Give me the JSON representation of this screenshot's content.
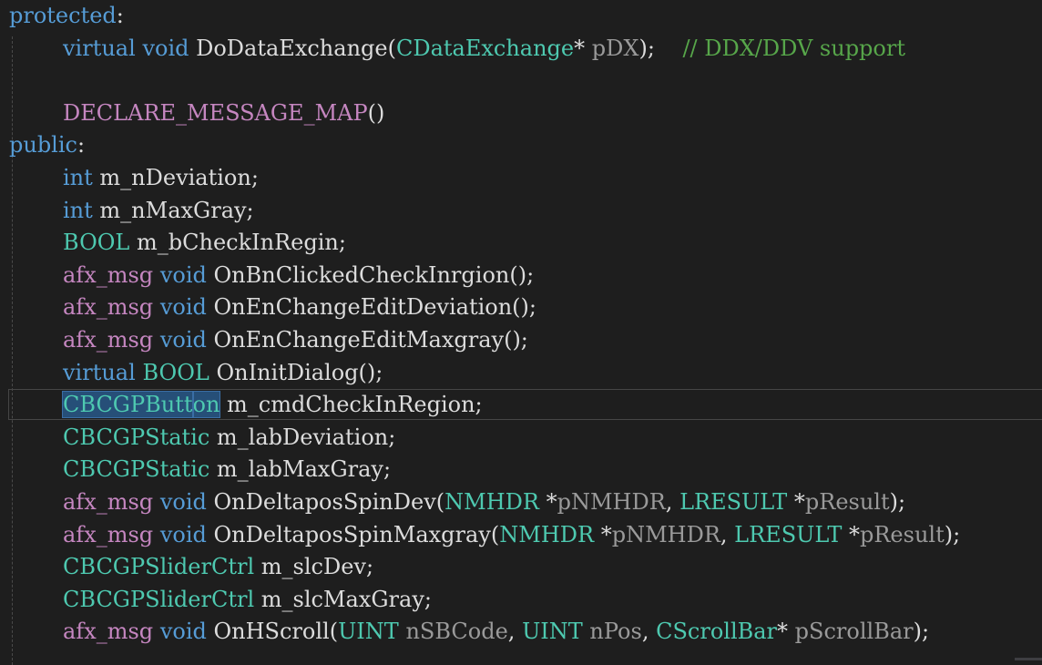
{
  "editor": {
    "lines": [
      {
        "indent": 0,
        "tokens": [
          {
            "t": "protected",
            "c": "kw"
          },
          {
            "t": ":",
            "c": "plain"
          }
        ]
      },
      {
        "indent": 1,
        "tokens": [
          {
            "t": "virtual",
            "c": "kw"
          },
          {
            "t": " ",
            "c": "plain"
          },
          {
            "t": "void",
            "c": "kw"
          },
          {
            "t": " DoDataExchange(",
            "c": "plain"
          },
          {
            "t": "CDataExchange",
            "c": "type"
          },
          {
            "t": "* ",
            "c": "plain"
          },
          {
            "t": "pDX",
            "c": "param"
          },
          {
            "t": ");    ",
            "c": "plain"
          },
          {
            "t": "// DDX/DDV support",
            "c": "cmt"
          }
        ]
      },
      {
        "indent": 1,
        "tokens": []
      },
      {
        "indent": 1,
        "tokens": [
          {
            "t": "DECLARE_MESSAGE_MAP",
            "c": "macro"
          },
          {
            "t": "()",
            "c": "plain"
          }
        ]
      },
      {
        "indent": 0,
        "tokens": [
          {
            "t": "public",
            "c": "kw"
          },
          {
            "t": ":",
            "c": "plain"
          }
        ]
      },
      {
        "indent": 1,
        "tokens": [
          {
            "t": "int",
            "c": "kw"
          },
          {
            "t": " m_nDeviation;",
            "c": "plain"
          }
        ]
      },
      {
        "indent": 1,
        "tokens": [
          {
            "t": "int",
            "c": "kw"
          },
          {
            "t": " m_nMaxGray;",
            "c": "plain"
          }
        ]
      },
      {
        "indent": 1,
        "tokens": [
          {
            "t": "BOOL",
            "c": "type"
          },
          {
            "t": " m_bCheckInRegin;",
            "c": "plain"
          }
        ]
      },
      {
        "indent": 1,
        "tokens": [
          {
            "t": "afx_msg",
            "c": "macro"
          },
          {
            "t": " ",
            "c": "plain"
          },
          {
            "t": "void",
            "c": "kw"
          },
          {
            "t": " OnBnClickedCheckInrgion();",
            "c": "plain"
          }
        ]
      },
      {
        "indent": 1,
        "tokens": [
          {
            "t": "afx_msg",
            "c": "macro"
          },
          {
            "t": " ",
            "c": "plain"
          },
          {
            "t": "void",
            "c": "kw"
          },
          {
            "t": " OnEnChangeEditDeviation();",
            "c": "plain"
          }
        ]
      },
      {
        "indent": 1,
        "tokens": [
          {
            "t": "afx_msg",
            "c": "macro"
          },
          {
            "t": " ",
            "c": "plain"
          },
          {
            "t": "void",
            "c": "kw"
          },
          {
            "t": " OnEnChangeEditMaxgray();",
            "c": "plain"
          }
        ]
      },
      {
        "indent": 1,
        "tokens": [
          {
            "t": "virtual",
            "c": "kw"
          },
          {
            "t": " ",
            "c": "plain"
          },
          {
            "t": "BOOL",
            "c": "type"
          },
          {
            "t": " OnInitDialog();",
            "c": "plain"
          }
        ]
      },
      {
        "indent": 1,
        "current": true,
        "tokens": [
          {
            "t": "CBCGPButt",
            "c": "type",
            "sel": true
          },
          {
            "caret": true
          },
          {
            "t": "on",
            "c": "type",
            "sel": true
          },
          {
            "t": " m_cmdCheckInRegion;",
            "c": "plain"
          }
        ]
      },
      {
        "indent": 1,
        "tokens": [
          {
            "t": "CBCGPStatic",
            "c": "type"
          },
          {
            "t": " m_labDeviation;",
            "c": "plain"
          }
        ]
      },
      {
        "indent": 1,
        "tokens": [
          {
            "t": "CBCGPStatic",
            "c": "type"
          },
          {
            "t": " m_labMaxGray;",
            "c": "plain"
          }
        ]
      },
      {
        "indent": 1,
        "tokens": [
          {
            "t": "afx_msg",
            "c": "macro"
          },
          {
            "t": " ",
            "c": "plain"
          },
          {
            "t": "void",
            "c": "kw"
          },
          {
            "t": " OnDeltaposSpinDev(",
            "c": "plain"
          },
          {
            "t": "NMHDR",
            "c": "type"
          },
          {
            "t": " *",
            "c": "plain"
          },
          {
            "t": "pNMHDR",
            "c": "param"
          },
          {
            "t": ", ",
            "c": "plain"
          },
          {
            "t": "LRESULT",
            "c": "type"
          },
          {
            "t": " *",
            "c": "plain"
          },
          {
            "t": "pResult",
            "c": "param"
          },
          {
            "t": ");",
            "c": "plain"
          }
        ]
      },
      {
        "indent": 1,
        "tokens": [
          {
            "t": "afx_msg",
            "c": "macro"
          },
          {
            "t": " ",
            "c": "plain"
          },
          {
            "t": "void",
            "c": "kw"
          },
          {
            "t": " OnDeltaposSpinMaxgray(",
            "c": "plain"
          },
          {
            "t": "NMHDR",
            "c": "type"
          },
          {
            "t": " *",
            "c": "plain"
          },
          {
            "t": "pNMHDR",
            "c": "param"
          },
          {
            "t": ", ",
            "c": "plain"
          },
          {
            "t": "LRESULT",
            "c": "type"
          },
          {
            "t": " *",
            "c": "plain"
          },
          {
            "t": "pResult",
            "c": "param"
          },
          {
            "t": ");",
            "c": "plain"
          }
        ]
      },
      {
        "indent": 1,
        "tokens": [
          {
            "t": "CBCGPSliderCtrl",
            "c": "type"
          },
          {
            "t": " m_slcDev;",
            "c": "plain"
          }
        ]
      },
      {
        "indent": 1,
        "tokens": [
          {
            "t": "CBCGPSliderCtrl",
            "c": "type"
          },
          {
            "t": " m_slcMaxGray;",
            "c": "plain"
          }
        ]
      },
      {
        "indent": 1,
        "tokens": [
          {
            "t": "afx_msg",
            "c": "macro"
          },
          {
            "t": " ",
            "c": "plain"
          },
          {
            "t": "void",
            "c": "kw"
          },
          {
            "t": " OnHScroll(",
            "c": "plain"
          },
          {
            "t": "UINT",
            "c": "type"
          },
          {
            "t": " ",
            "c": "plain"
          },
          {
            "t": "nSBCode",
            "c": "param"
          },
          {
            "t": ", ",
            "c": "plain"
          },
          {
            "t": "UINT",
            "c": "type"
          },
          {
            "t": " ",
            "c": "plain"
          },
          {
            "t": "nPos",
            "c": "param"
          },
          {
            "t": ", ",
            "c": "plain"
          },
          {
            "t": "CScrollBar",
            "c": "type"
          },
          {
            "t": "* ",
            "c": "plain"
          },
          {
            "t": "pScrollBar",
            "c": "param"
          },
          {
            "t": ");",
            "c": "plain"
          }
        ]
      }
    ]
  }
}
